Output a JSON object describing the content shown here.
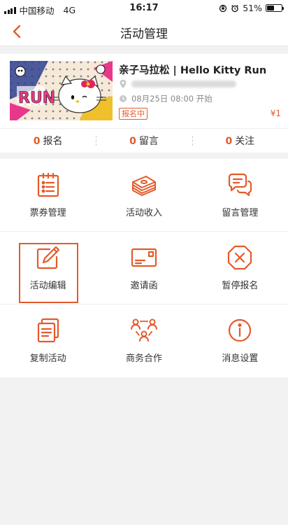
{
  "status_bar": {
    "carrier": "中国移动",
    "network": "4G",
    "time": "16:17",
    "battery_text": "51%",
    "battery_level": 0.51
  },
  "nav": {
    "title": "活动管理",
    "back_icon": "chevron-left-icon",
    "accent_color": "#e45a2b"
  },
  "event": {
    "title": "亲子马拉松 | Hello Kitty Run",
    "time": "08月25日 08:00 开始",
    "status": "报名中",
    "price": "¥1",
    "thumb_text": "RUN"
  },
  "stats": [
    {
      "count": "0",
      "label": "报名"
    },
    {
      "count": "0",
      "label": "留言"
    },
    {
      "count": "0",
      "label": "关注"
    }
  ],
  "grid": [
    {
      "label": "票券管理",
      "icon": "ticket-list-icon"
    },
    {
      "label": "活动收入",
      "icon": "money-stack-icon"
    },
    {
      "label": "留言管理",
      "icon": "chat-bubbles-icon"
    },
    {
      "label": "活动编辑",
      "icon": "edit-pencil-icon"
    },
    {
      "label": "邀请函",
      "icon": "invitation-card-icon"
    },
    {
      "label": "暂停报名",
      "icon": "stop-octagon-icon"
    },
    {
      "label": "复制活动",
      "icon": "copy-docs-icon"
    },
    {
      "label": "商务合作",
      "icon": "people-network-icon"
    },
    {
      "label": "消息设置",
      "icon": "info-circle-icon"
    }
  ]
}
